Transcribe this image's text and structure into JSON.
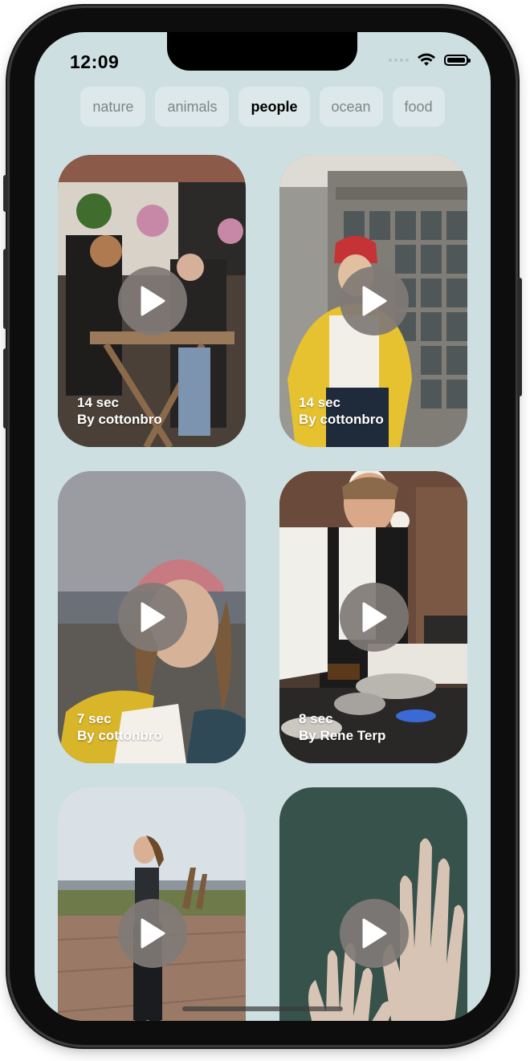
{
  "status_bar": {
    "time": "12:09"
  },
  "chips": [
    {
      "label": "nature",
      "active": false
    },
    {
      "label": "animals",
      "active": false
    },
    {
      "label": "people",
      "active": true
    },
    {
      "label": "ocean",
      "active": false
    },
    {
      "label": "food",
      "active": false
    }
  ],
  "videos": [
    {
      "duration": "14 sec",
      "author": "By cottonbro",
      "scene": "cafe-couple"
    },
    {
      "duration": "14 sec",
      "author": "By cottonbro",
      "scene": "yellow-raincoat-building"
    },
    {
      "duration": "7 sec",
      "author": "By cottonbro",
      "scene": "woman-pink-beanie"
    },
    {
      "duration": "8 sec",
      "author": "By Rene Terp",
      "scene": "waiter-kitchen"
    },
    {
      "duration": "",
      "author": "",
      "scene": "woman-walking-boardwalk"
    },
    {
      "duration": "",
      "author": "",
      "scene": "hands-green-background"
    }
  ],
  "colors": {
    "background": "#cddfe1",
    "chip": "#dce8ea",
    "play_button": "#807a76"
  }
}
